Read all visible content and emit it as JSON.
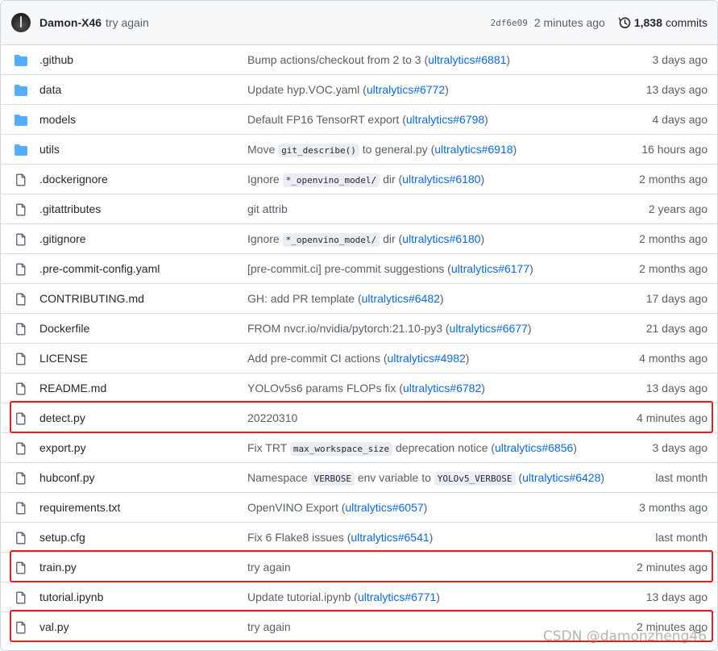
{
  "header": {
    "author": "Damon-X46",
    "message": "try again",
    "sha": "2df6e09",
    "time": "2 minutes ago",
    "commit_count": "1,838",
    "commits_label": "commits",
    "history_icon": "history-icon"
  },
  "files": [
    {
      "type": "dir",
      "name": ".github",
      "msg": [
        {
          "t": "Bump actions/checkout from 2 to 3 ("
        },
        {
          "l": "ultralytics#6881"
        },
        {
          "t": ")"
        }
      ],
      "age": "3 days ago"
    },
    {
      "type": "dir",
      "name": "data",
      "msg": [
        {
          "t": "Update hyp.VOC.yaml ("
        },
        {
          "l": "ultralytics#6772"
        },
        {
          "t": ")"
        }
      ],
      "age": "13 days ago"
    },
    {
      "type": "dir",
      "name": "models",
      "msg": [
        {
          "t": "Default FP16 TensorRT export ("
        },
        {
          "l": "ultralytics#6798"
        },
        {
          "t": ")"
        }
      ],
      "age": "4 days ago"
    },
    {
      "type": "dir",
      "name": "utils",
      "msg": [
        {
          "t": "Move "
        },
        {
          "c": "git_describe()"
        },
        {
          "t": " to general.py ("
        },
        {
          "l": "ultralytics#6918"
        },
        {
          "t": ")"
        }
      ],
      "age": "16 hours ago"
    },
    {
      "type": "file",
      "name": ".dockerignore",
      "msg": [
        {
          "t": "Ignore "
        },
        {
          "c": "*_openvino_model/"
        },
        {
          "t": " dir ("
        },
        {
          "l": "ultralytics#6180"
        },
        {
          "t": ")"
        }
      ],
      "age": "2 months ago"
    },
    {
      "type": "file",
      "name": ".gitattributes",
      "msg": [
        {
          "t": "git attrib"
        }
      ],
      "age": "2 years ago"
    },
    {
      "type": "file",
      "name": ".gitignore",
      "msg": [
        {
          "t": "Ignore "
        },
        {
          "c": "*_openvino_model/"
        },
        {
          "t": " dir ("
        },
        {
          "l": "ultralytics#6180"
        },
        {
          "t": ")"
        }
      ],
      "age": "2 months ago"
    },
    {
      "type": "file",
      "name": ".pre-commit-config.yaml",
      "msg": [
        {
          "t": "[pre-commit.ci] pre-commit suggestions ("
        },
        {
          "l": "ultralytics#6177"
        },
        {
          "t": ")"
        }
      ],
      "age": "2 months ago"
    },
    {
      "type": "file",
      "name": "CONTRIBUTING.md",
      "msg": [
        {
          "t": "GH: add PR template ("
        },
        {
          "l": "ultralytics#6482"
        },
        {
          "t": ")"
        }
      ],
      "age": "17 days ago"
    },
    {
      "type": "file",
      "name": "Dockerfile",
      "msg": [
        {
          "t": "FROM nvcr.io/nvidia/pytorch:21.10-py3 ("
        },
        {
          "l": "ultralytics#6677"
        },
        {
          "t": ")"
        }
      ],
      "age": "21 days ago"
    },
    {
      "type": "file",
      "name": "LICENSE",
      "msg": [
        {
          "t": "Add pre-commit CI actions ("
        },
        {
          "l": "ultralytics#4982"
        },
        {
          "t": ")"
        }
      ],
      "age": "4 months ago"
    },
    {
      "type": "file",
      "name": "README.md",
      "msg": [
        {
          "t": "YOLOv5s6 params FLOPs fix ("
        },
        {
          "l": "ultralytics#6782"
        },
        {
          "t": ")"
        }
      ],
      "age": "13 days ago"
    },
    {
      "type": "file",
      "name": "detect.py",
      "msg": [
        {
          "t": "20220310"
        }
      ],
      "age": "4 minutes ago",
      "highlight": true
    },
    {
      "type": "file",
      "name": "export.py",
      "msg": [
        {
          "t": "Fix TRT "
        },
        {
          "c": "max_workspace_size"
        },
        {
          "t": " deprecation notice ("
        },
        {
          "l": "ultralytics#6856"
        },
        {
          "t": ")"
        }
      ],
      "age": "3 days ago"
    },
    {
      "type": "file",
      "name": "hubconf.py",
      "msg": [
        {
          "t": "Namespace "
        },
        {
          "c": "VERBOSE"
        },
        {
          "t": " env variable to "
        },
        {
          "c": "YOLOv5_VERBOSE"
        },
        {
          "t": " ("
        },
        {
          "l": "ultralytics#6428"
        },
        {
          "t": ")"
        }
      ],
      "age": "last month"
    },
    {
      "type": "file",
      "name": "requirements.txt",
      "msg": [
        {
          "t": "OpenVINO Export ("
        },
        {
          "l": "ultralytics#6057"
        },
        {
          "t": ")"
        }
      ],
      "age": "3 months ago"
    },
    {
      "type": "file",
      "name": "setup.cfg",
      "msg": [
        {
          "t": "Fix 6 Flake8 issues ("
        },
        {
          "l": "ultralytics#6541"
        },
        {
          "t": ")"
        }
      ],
      "age": "last month"
    },
    {
      "type": "file",
      "name": "train.py",
      "msg": [
        {
          "t": "try again"
        }
      ],
      "age": "2 minutes ago",
      "highlight": true
    },
    {
      "type": "file",
      "name": "tutorial.ipynb",
      "msg": [
        {
          "t": "Update tutorial.ipynb ("
        },
        {
          "l": "ultralytics#6771"
        },
        {
          "t": ")"
        }
      ],
      "age": "13 days ago"
    },
    {
      "type": "file",
      "name": "val.py",
      "msg": [
        {
          "t": "try again"
        }
      ],
      "age": "2 minutes ago",
      "highlight": true
    }
  ],
  "watermark": "CSDN @damonzheng46",
  "colors": {
    "folder": "#54aeff",
    "link": "#0969da",
    "highlight": "#e02020"
  }
}
